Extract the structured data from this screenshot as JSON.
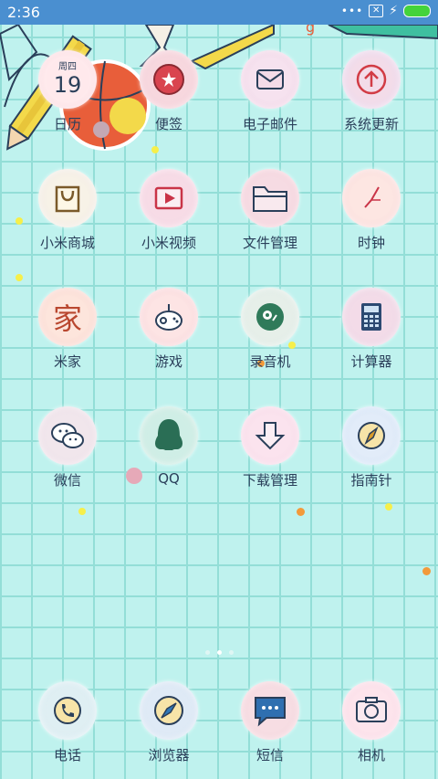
{
  "status_bar": {
    "time": "2:36",
    "signal_dots": "•••",
    "battery_level": 1.0,
    "battery_color": "#44d33b",
    "bar_color": "#4a8fd0"
  },
  "calendar_icon": {
    "weekday": "周四",
    "day": "19"
  },
  "apps": [
    {
      "label": "日历",
      "icon": "calendar-icon"
    },
    {
      "label": "便签",
      "icon": "notes-icon"
    },
    {
      "label": "电子邮件",
      "icon": "email-icon"
    },
    {
      "label": "系统更新",
      "icon": "update-icon"
    },
    {
      "label": "小米商城",
      "icon": "shopping-bag-icon"
    },
    {
      "label": "小米视频",
      "icon": "video-icon"
    },
    {
      "label": "文件管理",
      "icon": "folder-icon"
    },
    {
      "label": "时钟",
      "icon": "clock-icon"
    },
    {
      "label": "米家",
      "icon": "mijia-icon",
      "glyph": "家"
    },
    {
      "label": "游戏",
      "icon": "gamepad-icon"
    },
    {
      "label": "录音机",
      "icon": "recorder-icon"
    },
    {
      "label": "计算器",
      "icon": "calculator-icon"
    },
    {
      "label": "微信",
      "icon": "wechat-icon"
    },
    {
      "label": "QQ",
      "icon": "qq-icon"
    },
    {
      "label": "下载管理",
      "icon": "download-icon"
    },
    {
      "label": "指南针",
      "icon": "compass-icon"
    }
  ],
  "dock": [
    {
      "label": "电话",
      "icon": "phone-icon"
    },
    {
      "label": "浏览器",
      "icon": "browser-icon"
    },
    {
      "label": "短信",
      "icon": "message-icon"
    },
    {
      "label": "相机",
      "icon": "camera-icon"
    }
  ],
  "page_indicator": {
    "pages": 3,
    "current": 2
  }
}
